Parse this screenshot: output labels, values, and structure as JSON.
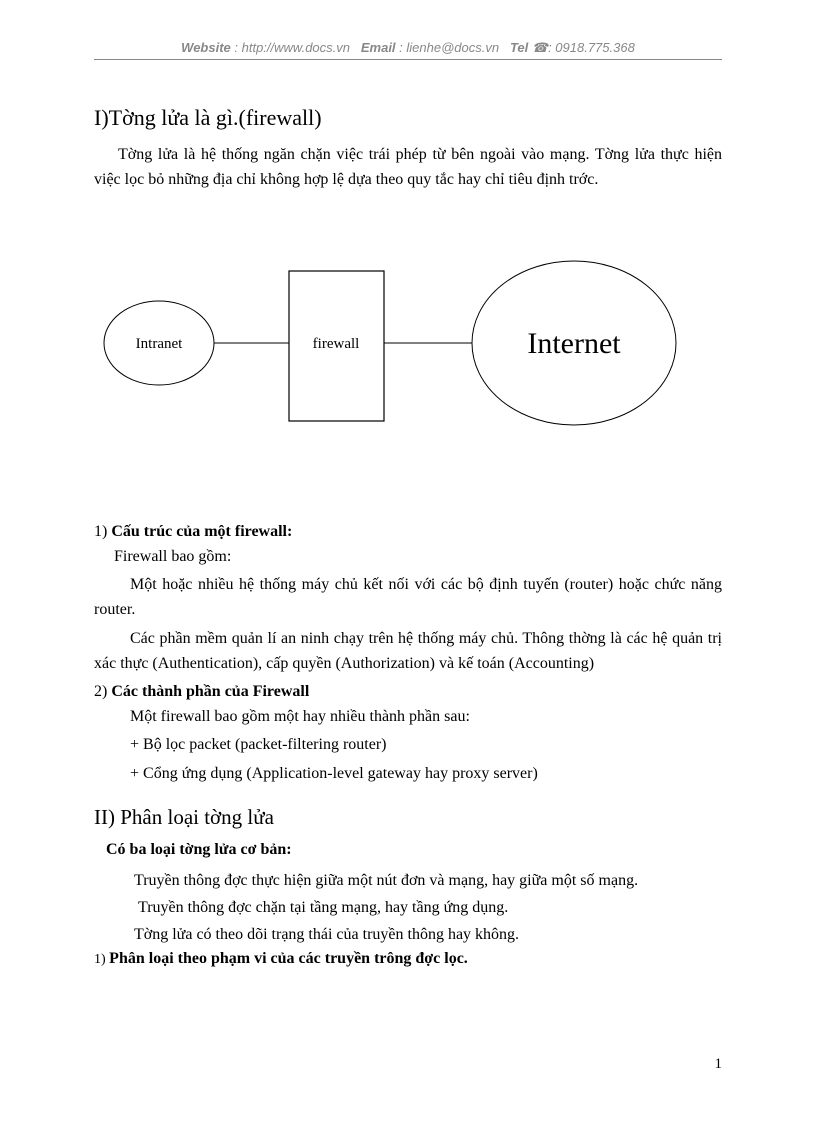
{
  "header": {
    "website_label": "Website",
    "website_sep": " : ",
    "website_url": "http://www.docs.vn",
    "email_label": "Email",
    "email_sep": " : ",
    "email_value": "lienhe@docs.vn",
    "tel_label": "Tel",
    "tel_icon": " ☎",
    "tel_sep": ": ",
    "tel_value": "0918.775.368"
  },
  "sections": {
    "s1": {
      "heading": "I)Tờng   lửa là gì.(firewall)",
      "p1": "Tờng   lửa là hệ thống ngăn chặn việc trái phép từ bên ngoài vào mạng. Tờng   lửa thực hiện việc lọc bỏ những địa chỉ không hợp lệ dựa theo quy tắc hay chỉ tiêu định trớc.",
      "sub1_num": "1) ",
      "sub1_title": "Cấu trúc của một firewall:",
      "sub1_p1": "Firewall bao gồm:",
      "sub1_p2": "Một hoặc nhiều hệ thống máy chủ kết nối với các bộ định tuyến (router) hoặc chức năng router.",
      "sub1_p3": "Các phần mềm quản lí an ninh chạy trên hệ thống máy chủ. Thông thờng   là các hệ quản trị xác thực (Authentication), cấp quyền  (Authorization) và kế toán (Accounting)",
      "sub2_num": " 2) ",
      "sub2_title": "Các thành phần của Firewall",
      "sub2_p1": "Một firewall bao gồm một hay nhiều thành phần sau:",
      "sub2_l1": "+ Bộ lọc packet (packet-filtering router)",
      "sub2_l2": "+ Cổng ứng dụng (Application-level gateway hay proxy server)"
    },
    "s2": {
      "heading": "II) Phân loại tờng   lửa",
      "lead": "Có ba loại tờng   lửa cơ bản:",
      "l1": "Truyền thông đợc   thực hiện giữa một nút đơn và mạng, hay giữa một số mạng.",
      "l2": "Truyền thông đợc   chặn tại tầng mạng, hay tầng ứng dụng.",
      "l3": "Tờng   lửa có theo dõi trạng thái của truyền thông hay không.",
      "sub1_num": "1) ",
      "sub1_title": "Phân loại theo phạm vi của các truyền trông đợc   lọc."
    }
  },
  "diagram": {
    "left": "Intranet",
    "center": "firewall",
    "right": "Internet"
  },
  "page_number": "1"
}
